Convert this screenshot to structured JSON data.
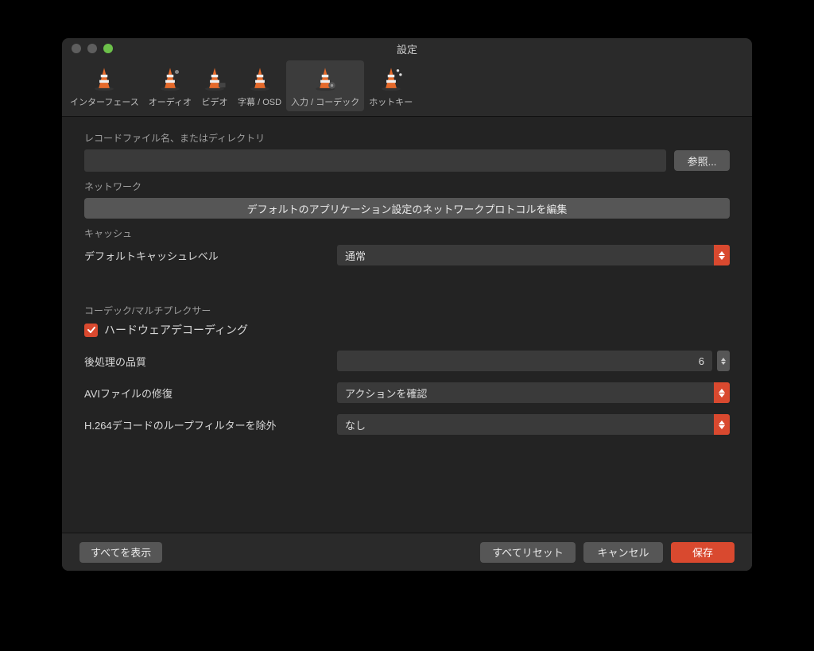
{
  "window": {
    "title": "設定"
  },
  "tabs": [
    {
      "label": "インターフェース"
    },
    {
      "label": "オーディオ"
    },
    {
      "label": "ビデオ"
    },
    {
      "label": "字幕 / OSD"
    },
    {
      "label": "入力 / コーデック"
    },
    {
      "label": "ホットキー"
    }
  ],
  "record": {
    "section": "レコードファイル名、またはディレクトリ",
    "path": "",
    "browse": "参照..."
  },
  "network": {
    "section": "ネットワーク",
    "edit_button": "デフォルトのアプリケーション設定のネットワークプロトコルを編集"
  },
  "cache": {
    "section": "キャッシュ",
    "label": "デフォルトキャッシュレベル",
    "value": "通常"
  },
  "codec": {
    "section": "コーデック/マルチプレクサー",
    "hw_decode": "ハードウェアデコーディング",
    "postproc_label": "後処理の品質",
    "postproc_value": "6",
    "avi_label": "AVIファイルの修復",
    "avi_value": "アクションを確認",
    "h264_label": "H.264デコードのループフィルターを除外",
    "h264_value": "なし"
  },
  "footer": {
    "show_all": "すべてを表示",
    "reset_all": "すべてリセット",
    "cancel": "キャンセル",
    "save": "保存"
  },
  "colors": {
    "accent": "#d9492f"
  }
}
